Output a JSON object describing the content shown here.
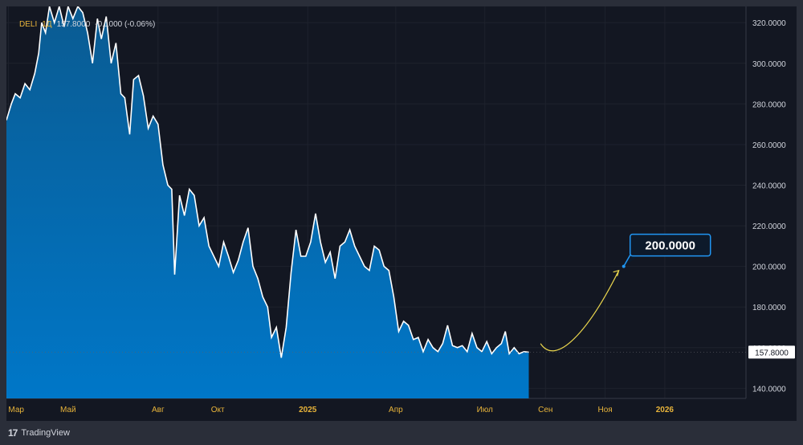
{
  "legend": {
    "symbol": "DELI",
    "interval": "1Д",
    "last": "157.8000",
    "change": "-0.1000 (-0.06%)"
  },
  "branding": {
    "name": "TradingView",
    "logo_glyph": "17"
  },
  "colors": {
    "background": "#131722",
    "frame": "#2a2e39",
    "line": "#ffffff",
    "area": "#0077c8",
    "projection": "#e8d44d",
    "callout_border": "#2196f3",
    "callout_fill": "#0d1a2b",
    "x_label": "#e8b43a",
    "y_label": "#d1d4dc"
  },
  "chart_data": {
    "type": "area",
    "ylim": [
      135,
      328
    ],
    "y_ticks": [
      140,
      160,
      180,
      200,
      220,
      240,
      260,
      280,
      300,
      320
    ],
    "y_tick_labels": [
      "140.0000",
      "160.0000",
      "180.0000",
      "200.0000",
      "220.0000",
      "240.0000",
      "260.0000",
      "280.0000",
      "300.0000",
      "320.0000"
    ],
    "x_ticks": [
      {
        "label": "Мар",
        "date": "2024-03-01"
      },
      {
        "label": "Май",
        "date": "2024-05-01"
      },
      {
        "label": "Авг",
        "date": "2024-08-01"
      },
      {
        "label": "Окт",
        "date": "2024-10-01"
      },
      {
        "label": "2025",
        "date": "2025-01-01",
        "bold": true
      },
      {
        "label": "Апр",
        "date": "2025-04-01"
      },
      {
        "label": "Июл",
        "date": "2025-07-01"
      },
      {
        "label": "Сен",
        "date": "2025-09-01"
      },
      {
        "label": "Ноя",
        "date": "2025-11-01"
      },
      {
        "label": "2026",
        "date": "2026-01-01",
        "bold": true
      }
    ],
    "x_range": [
      "2024-02-28",
      "2026-03-25"
    ],
    "series": [
      {
        "values": [
          [
            "2024-02-28",
            272
          ],
          [
            "2024-03-04",
            280
          ],
          [
            "2024-03-08",
            285
          ],
          [
            "2024-03-13",
            283
          ],
          [
            "2024-03-18",
            290
          ],
          [
            "2024-03-23",
            287
          ],
          [
            "2024-03-28",
            295
          ],
          [
            "2024-04-01",
            305
          ],
          [
            "2024-04-04",
            320
          ],
          [
            "2024-04-08",
            315
          ],
          [
            "2024-04-12",
            330
          ],
          [
            "2024-04-17",
            320
          ],
          [
            "2024-04-22",
            335
          ],
          [
            "2024-04-27",
            318
          ],
          [
            "2024-05-01",
            330
          ],
          [
            "2024-05-06",
            322
          ],
          [
            "2024-05-11",
            336
          ],
          [
            "2024-05-16",
            325
          ],
          [
            "2024-05-21",
            315
          ],
          [
            "2024-05-26",
            300
          ],
          [
            "2024-05-31",
            322
          ],
          [
            "2024-06-04",
            312
          ],
          [
            "2024-06-09",
            323
          ],
          [
            "2024-06-14",
            300
          ],
          [
            "2024-06-19",
            310
          ],
          [
            "2024-06-24",
            285
          ],
          [
            "2024-06-28",
            283
          ],
          [
            "2024-07-03",
            265
          ],
          [
            "2024-07-07",
            292
          ],
          [
            "2024-07-12",
            294
          ],
          [
            "2024-07-17",
            284
          ],
          [
            "2024-07-22",
            268
          ],
          [
            "2024-07-27",
            274
          ],
          [
            "2024-08-01",
            270
          ],
          [
            "2024-08-06",
            250
          ],
          [
            "2024-08-11",
            240
          ],
          [
            "2024-08-15",
            238
          ],
          [
            "2024-08-18",
            196
          ],
          [
            "2024-08-23",
            235
          ],
          [
            "2024-08-28",
            225
          ],
          [
            "2024-09-02",
            238
          ],
          [
            "2024-09-07",
            235
          ],
          [
            "2024-09-12",
            220
          ],
          [
            "2024-09-17",
            224
          ],
          [
            "2024-09-22",
            210
          ],
          [
            "2024-09-27",
            205
          ],
          [
            "2024-10-02",
            200
          ],
          [
            "2024-10-07",
            212
          ],
          [
            "2024-10-12",
            205
          ],
          [
            "2024-10-17",
            197
          ],
          [
            "2024-10-22",
            203
          ],
          [
            "2024-10-27",
            212
          ],
          [
            "2024-11-01",
            219
          ],
          [
            "2024-11-06",
            200
          ],
          [
            "2024-11-11",
            194
          ],
          [
            "2024-11-16",
            185
          ],
          [
            "2024-11-21",
            180
          ],
          [
            "2024-11-25",
            165
          ],
          [
            "2024-11-30",
            170
          ],
          [
            "2024-12-05",
            155
          ],
          [
            "2024-12-10",
            170
          ],
          [
            "2024-12-15",
            197
          ],
          [
            "2024-12-20",
            218
          ],
          [
            "2024-12-25",
            205
          ],
          [
            "2024-12-30",
            205
          ],
          [
            "2025-01-04",
            212
          ],
          [
            "2025-01-09",
            226
          ],
          [
            "2025-01-14",
            212
          ],
          [
            "2025-01-19",
            202
          ],
          [
            "2025-01-24",
            207
          ],
          [
            "2025-01-29",
            194
          ],
          [
            "2025-02-03",
            210
          ],
          [
            "2025-02-08",
            212
          ],
          [
            "2025-02-13",
            218
          ],
          [
            "2025-02-18",
            210
          ],
          [
            "2025-02-23",
            205
          ],
          [
            "2025-02-28",
            200
          ],
          [
            "2025-03-05",
            198
          ],
          [
            "2025-03-10",
            210
          ],
          [
            "2025-03-15",
            208
          ],
          [
            "2025-03-20",
            200
          ],
          [
            "2025-03-25",
            198
          ],
          [
            "2025-03-30",
            185
          ],
          [
            "2025-04-04",
            168
          ],
          [
            "2025-04-09",
            173
          ],
          [
            "2025-04-14",
            171
          ],
          [
            "2025-04-19",
            164
          ],
          [
            "2025-04-24",
            165
          ],
          [
            "2025-04-29",
            158
          ],
          [
            "2025-05-04",
            164
          ],
          [
            "2025-05-09",
            160
          ],
          [
            "2025-05-14",
            158
          ],
          [
            "2025-05-19",
            162
          ],
          [
            "2025-05-24",
            171
          ],
          [
            "2025-05-29",
            161
          ],
          [
            "2025-06-03",
            160
          ],
          [
            "2025-06-08",
            161
          ],
          [
            "2025-06-13",
            158
          ],
          [
            "2025-06-18",
            167
          ],
          [
            "2025-06-23",
            160
          ],
          [
            "2025-06-28",
            158
          ],
          [
            "2025-07-03",
            163
          ],
          [
            "2025-07-08",
            157
          ],
          [
            "2025-07-13",
            160
          ],
          [
            "2025-07-18",
            162
          ],
          [
            "2025-07-22",
            168
          ],
          [
            "2025-07-26",
            157
          ],
          [
            "2025-07-31",
            160
          ],
          [
            "2025-08-05",
            157
          ],
          [
            "2025-08-10",
            158
          ],
          [
            "2025-08-15",
            157.8
          ]
        ]
      }
    ],
    "last_value_label": "157.8000",
    "last_value": 157.8,
    "projection": {
      "points": [
        [
          "2025-08-27",
          162
        ],
        [
          "2025-09-12",
          156
        ],
        [
          "2025-10-15",
          168
        ],
        [
          "2025-11-15",
          198
        ]
      ],
      "target_label": "200.0000",
      "target": [
        "2025-11-20",
        200
      ]
    }
  }
}
